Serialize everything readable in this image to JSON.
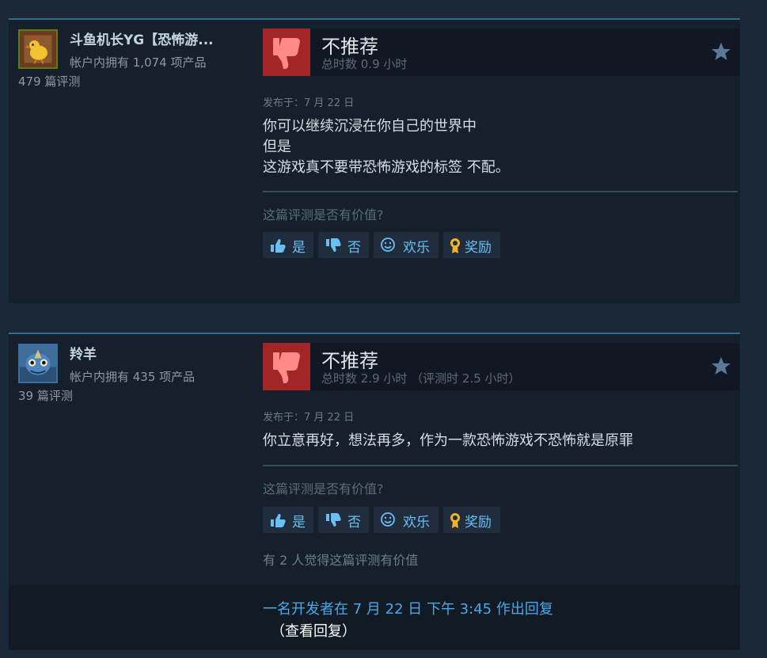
{
  "reviews": [
    {
      "author": "斗鱼机长YG【恐怖游...",
      "products_owned": "帐户内拥有 1,074 项产品",
      "review_count": "479 篇评测",
      "rating": "不推荐",
      "playtime": "总时数 0.9 小时",
      "posted": "发布于：7 月 22 日",
      "body": [
        "你可以继续沉浸在你自己的世界中",
        "但是",
        "这游戏真不要带恐怖游戏的标签 不配。"
      ],
      "helpful_question": "这篇评测是否有价值?",
      "buttons": {
        "yes": "是",
        "no": "否",
        "funny": "欢乐",
        "award": "奖励"
      }
    },
    {
      "author": "羚羊",
      "products_owned": "帐户内拥有 435 项产品",
      "review_count": "39 篇评测",
      "rating": "不推荐",
      "playtime": "总时数 2.9 小时 （评测时 2.5 小时）",
      "posted": "发布于：7 月 22 日",
      "body": [
        "你立意再好，想法再多，作为一款恐怖游戏不恐怖就是原罪"
      ],
      "helpful_question": "这篇评测是否有价值?",
      "buttons": {
        "yes": "是",
        "no": "否",
        "funny": "欢乐",
        "award": "奖励"
      },
      "found_helpful": "有 2 人觉得这篇评测有价值"
    }
  ],
  "developer_reply": {
    "text": "一名开发者在 7 月 22 日 下午 3:45 作出回复",
    "link": "（查看回复）"
  },
  "colors": {
    "background": "#1b2838",
    "card": "#16202d",
    "thumb_down_red": "#a22527",
    "link_blue": "#67c1f5",
    "award_gold": "#f0b429"
  },
  "icons": {
    "thumbs_down": "thumbs-down-icon",
    "star": "star-icon",
    "vote_up": "thumbs-up-icon",
    "vote_down": "thumbs-down-small-icon",
    "funny": "smile-icon",
    "award": "award-ribbon-icon"
  }
}
